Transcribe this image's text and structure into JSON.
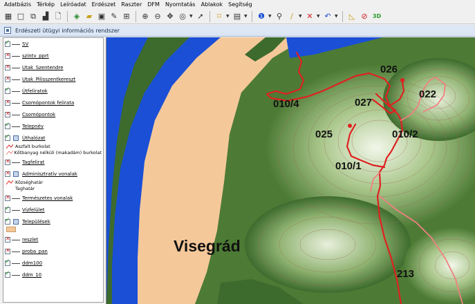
{
  "menu": [
    "Adatbázis",
    "Térkép",
    "Leíróadat",
    "Erdészet",
    "Raszter",
    "DFM",
    "Nyomtatás",
    "Ablakok",
    "Segítség"
  ],
  "window": {
    "title": "Erdészeti ütügyi információs rendszer"
  },
  "toolbar_icons": [
    "grid-icon",
    "new-map-icon",
    "window-icon",
    "stats-icon",
    "print-preview-icon",
    "layers-icon",
    "open-folder-icon",
    "save-icon",
    "edit-icon",
    "table-icon",
    "zoom-in-icon",
    "zoom-out-icon",
    "pan-icon",
    "query-icon",
    "select-icon",
    "marker-icon",
    "map-settings-icon",
    "info-icon",
    "find-icon",
    "pencil-icon",
    "delete-icon",
    "undo-icon",
    "measure-icon",
    "compass-icon",
    "3d-icon"
  ],
  "layers": [
    {
      "name": "SV",
      "visible": true
    },
    {
      "name": "szintv_pprt",
      "visible": false
    },
    {
      "name": "Utak_Szentendre",
      "visible": false
    },
    {
      "name": "Utak_Pilisszentkereszt",
      "visible": false
    },
    {
      "name": "Útfeliratok",
      "visible": true
    },
    {
      "name": "Csomópontok felirata",
      "visible": false
    },
    {
      "name": "Csomópontok",
      "visible": false
    },
    {
      "name": "Telepnév",
      "visible": true
    }
  ],
  "utthalozat": {
    "name": "Úthalózat",
    "visible": true,
    "sublayers": [
      "Aszfalt burkolat",
      "Kőtbanyag nélküli (makadám) burkolat"
    ]
  },
  "layers2": [
    {
      "name": "Tagfelirat",
      "visible": false
    }
  ],
  "admin": {
    "name": "Adminisztratív vonalak",
    "visible": false,
    "sublayers": [
      "Községhatár",
      "Taghatár"
    ]
  },
  "layers3": [
    {
      "name": "Természetes vonalak",
      "visible": false
    },
    {
      "name": "Vízfelület",
      "visible": true
    }
  ],
  "telepulesek": {
    "name": "Települések",
    "visible": true
  },
  "layers4": [
    {
      "name": "reszlet",
      "visible": false
    },
    {
      "name": "proba_pan",
      "visible": false
    },
    {
      "name": "ddm100",
      "visible": true
    },
    {
      "name": "ddm_10",
      "visible": true
    }
  ],
  "map_labels": {
    "l010_4": "010/4",
    "l026": "026",
    "l022": "022",
    "l027": "027",
    "l025": "025",
    "l010_2": "010/2",
    "l010_1": "010/1",
    "l213": "213",
    "city": "Visegrád"
  },
  "colors": {
    "water": "#1a4fd6",
    "settlement": "#f5c89a",
    "forest_dark": "#3d6b2e",
    "forest_mid": "#6f9a4e",
    "forest_light": "#a9c68a",
    "road_main": "#e02020",
    "road_light": "#f08080"
  }
}
